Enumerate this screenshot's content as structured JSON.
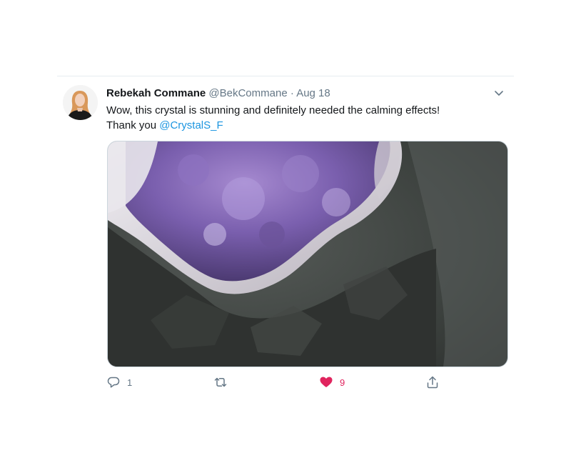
{
  "tweet": {
    "author_name": "Rebekah Commane",
    "author_handle": "@BekCommane",
    "separator": "·",
    "date": "Aug 18",
    "text_line1": "Wow, this crystal is stunning and definitely needed the calming effects!",
    "text_line2_prefix": "Thank you ",
    "mention": "@CrystalS_F",
    "counts": {
      "reply": "1",
      "like": "9"
    }
  },
  "colors": {
    "accent": "#1b95e0",
    "like_active": "#e0245e",
    "secondary_text": "#657786"
  },
  "icons": {
    "menu": "chevron-down-icon",
    "reply": "reply-bubble-icon",
    "retweet": "retweet-icon",
    "like": "heart-icon",
    "share": "share-icon"
  }
}
